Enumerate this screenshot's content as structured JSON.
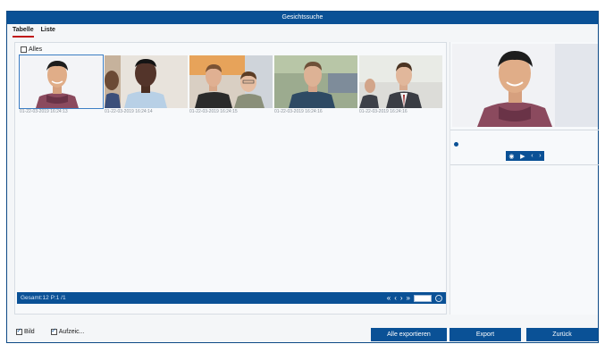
{
  "window": {
    "title": "Gesichtssuche"
  },
  "tabs": [
    {
      "label": "Tabelle",
      "active": true
    },
    {
      "label": "Liste",
      "active": false
    }
  ],
  "select_all": {
    "label": "Alles",
    "checked": false
  },
  "results": [
    {
      "caption": "01-22-03-2019 16:24:13",
      "selected": true
    },
    {
      "caption": "01-22-03-2019 16:24:14",
      "selected": false
    },
    {
      "caption": "01-22-03-2019 16:24:15",
      "selected": false
    },
    {
      "caption": "01-22-03-2019 16:24:16",
      "selected": false
    },
    {
      "caption": "01-22-03-2019 16:24:16",
      "selected": false
    }
  ],
  "pager": {
    "summary": "Gesamt:12 P:1 /1"
  },
  "bottom": {
    "bild_label": "Bild",
    "aufzeichnung_label": "Aufzeic..."
  },
  "buttons": {
    "export_all": "Alle exportieren",
    "export": "Export",
    "back": "Zurück"
  },
  "colors": {
    "accent": "#0a5196",
    "tab_underline": "#c01818"
  }
}
